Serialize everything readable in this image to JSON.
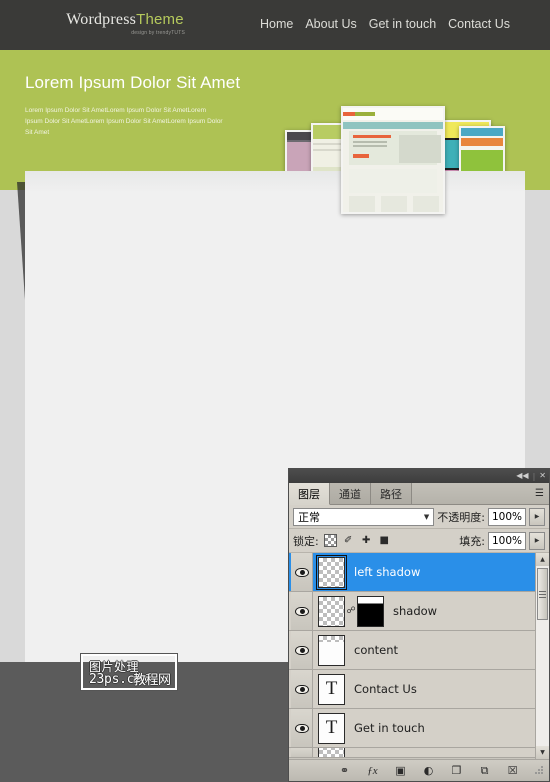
{
  "website": {
    "logo": {
      "main": "Wordpress",
      "accent": "Theme",
      "tagline": "design by trendyTUTS"
    },
    "nav": [
      {
        "label": "Home"
      },
      {
        "label": "About Us"
      },
      {
        "label": "Get in touch"
      },
      {
        "label": "Contact Us"
      }
    ],
    "hero": {
      "title": "Lorem Ipsum Dolor Sit Amet",
      "body": "Lorem Ipsum Dolor Sit AmetLorem Ipsum Dolor Sit AmetLorem Ipsum Dolor Sit AmetLorem Ipsum Dolor Sit AmetLorem Ipsum Dolor Sit Amet",
      "green": "#aec254"
    }
  },
  "watermark": {
    "line1": "图片处理",
    "line2": "23ps.com",
    "line3": "教程网"
  },
  "photoshop": {
    "titlebar": {
      "collapse": "◀◀",
      "separator": "|",
      "close": "✕"
    },
    "tabs": [
      {
        "label": "图层",
        "active": true
      },
      {
        "label": "通道",
        "active": false
      },
      {
        "label": "路径",
        "active": false
      }
    ],
    "panel_menu": "☰",
    "blend_mode": {
      "value": "正常",
      "caret": "▼"
    },
    "opacity": {
      "label": "不透明度:",
      "value": "100%",
      "stepper": "▶"
    },
    "lock": {
      "label": "锁定:",
      "icons": [
        "transparent-pixels",
        "image-pixels",
        "position",
        "all"
      ],
      "glyphs": {
        "brush": "✐",
        "move": "✚",
        "all": "■"
      }
    },
    "fill": {
      "label": "填充:",
      "value": "100%",
      "stepper": "▶"
    },
    "layers": [
      {
        "name": "left shadow",
        "selected": true,
        "kind": "pixel",
        "visible": true
      },
      {
        "name": "shadow",
        "selected": false,
        "kind": "masked",
        "visible": true
      },
      {
        "name": "content",
        "selected": false,
        "kind": "fill",
        "visible": true
      },
      {
        "name": "Contact Us",
        "selected": false,
        "kind": "text",
        "visible": true,
        "thumb_glyph": "T"
      },
      {
        "name": "Get in touch",
        "selected": false,
        "kind": "text",
        "visible": true,
        "thumb_glyph": "T"
      }
    ],
    "scrollbar": {
      "up": "▲",
      "down": "▼"
    },
    "footer_icons": [
      {
        "name": "link-layers",
        "glyph": "⚭"
      },
      {
        "name": "layer-style-fx",
        "glyph": "ƒx"
      },
      {
        "name": "add-layer-mask",
        "glyph": "▣"
      },
      {
        "name": "adjustment-layer",
        "glyph": "◐"
      },
      {
        "name": "new-group",
        "glyph": "❐"
      },
      {
        "name": "new-layer",
        "glyph": "⧉"
      },
      {
        "name": "delete-layer",
        "glyph": "☒"
      }
    ]
  }
}
